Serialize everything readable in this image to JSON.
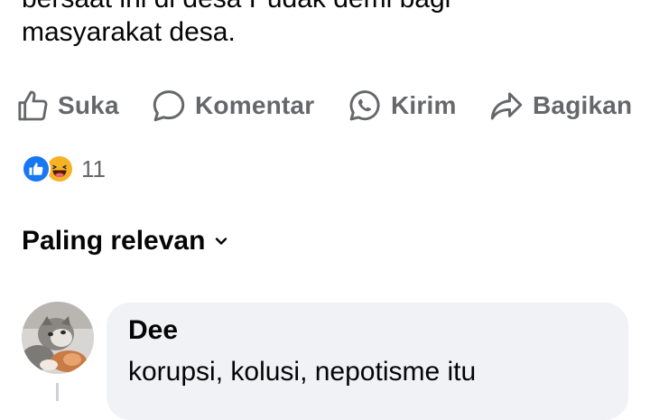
{
  "post": {
    "text_line_cut": "bersaat ini di desa Pudak demi bagi",
    "text_line": "masyarakat desa."
  },
  "actions": [
    {
      "label": "Suka",
      "icon": "thumbs-up-icon"
    },
    {
      "label": "Komentar",
      "icon": "comment-bubble-icon"
    },
    {
      "label": "Kirim",
      "icon": "whatsapp-icon"
    },
    {
      "label": "Bagikan",
      "icon": "share-arrow-icon"
    }
  ],
  "reactions": {
    "types": [
      "like-reaction-icon",
      "haha-reaction-icon"
    ],
    "count": "11"
  },
  "sort": {
    "label": "Paling relevan",
    "icon": "chevron-down-icon"
  },
  "comments": [
    {
      "author": "Dee",
      "text": "korupsi, kolusi, nepotisme itu",
      "avatar": "cat-photo-avatar"
    }
  ],
  "colors": {
    "text_primary": "#050505",
    "text_secondary": "#65676b",
    "like_blue": "#1877f2",
    "haha_yellow": "#f7b125",
    "bubble_bg": "#f0f2f5"
  }
}
